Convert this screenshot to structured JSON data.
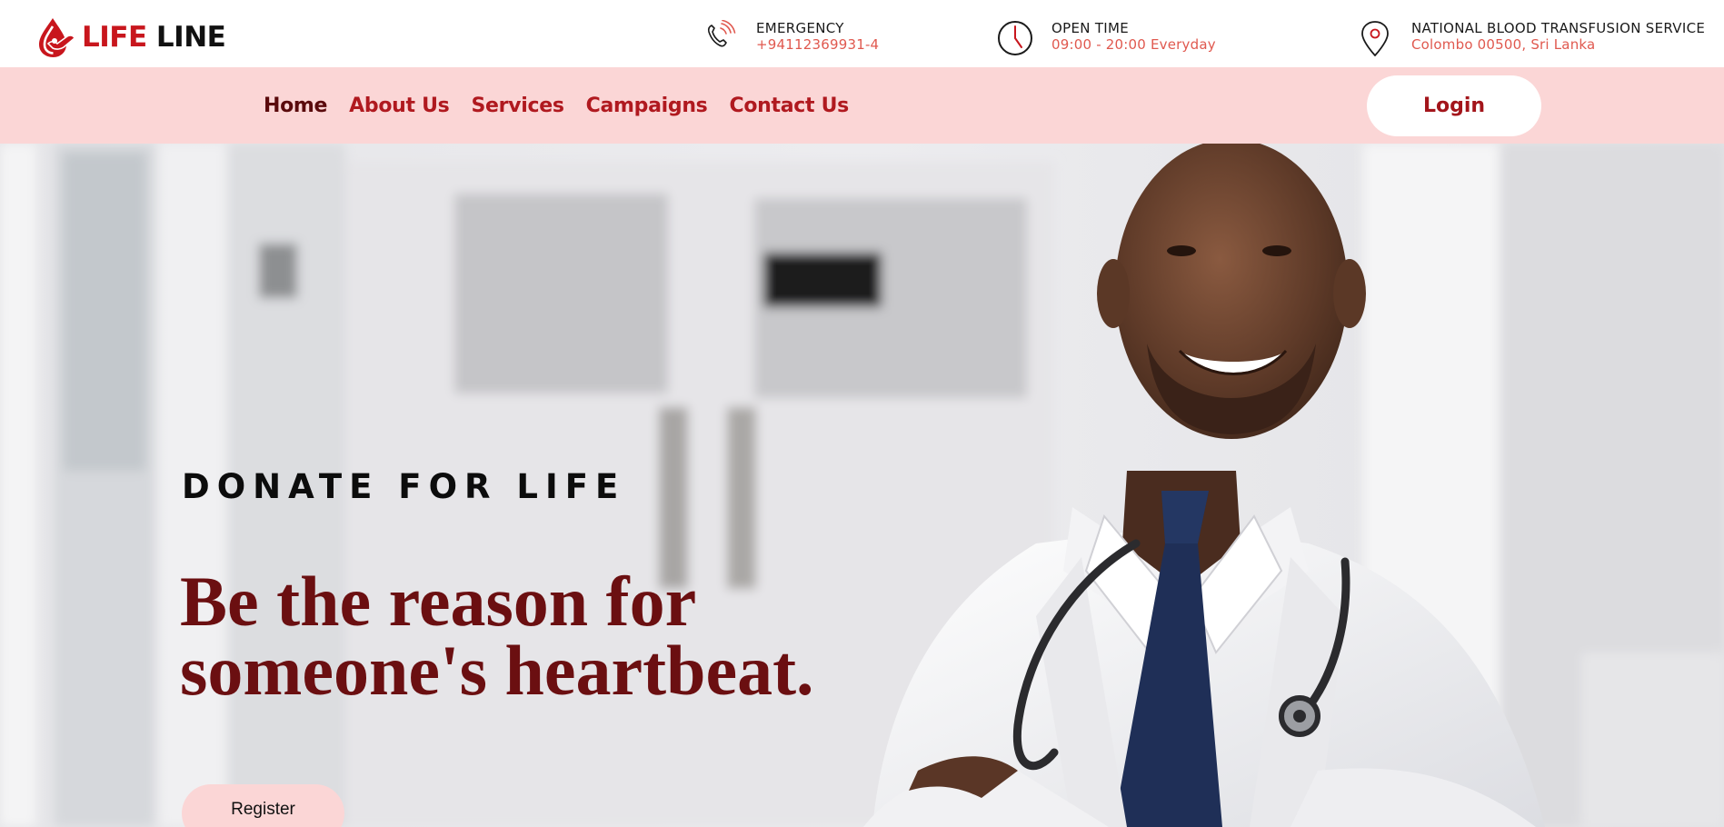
{
  "brand": {
    "name_part1": "LIFE",
    "name_part2": " LINE",
    "accent_color": "#c8161d"
  },
  "contact_info": [
    {
      "icon": "phone-icon",
      "label": "EMERGENCY",
      "value": "+94112369931-4"
    },
    {
      "icon": "clock-icon",
      "label": "OPEN TIME",
      "value": "09:00 - 20:00 Everyday"
    },
    {
      "icon": "location-pin-icon",
      "label": "NATIONAL BLOOD TRANSFUSION SERVICE",
      "value": "Colombo 00500, Sri Lanka"
    }
  ],
  "nav": {
    "items": [
      {
        "label": "Home",
        "active": true
      },
      {
        "label": "About Us",
        "active": false
      },
      {
        "label": "Services",
        "active": false
      },
      {
        "label": "Campaigns",
        "active": false
      },
      {
        "label": "Contact Us",
        "active": false
      }
    ],
    "login_label": "Login",
    "background_color": "#fbd6d6"
  },
  "hero": {
    "eyebrow": "DONATE FOR LIFE",
    "headline": "Be the reason for someone's heartbeat.",
    "register_label": "Register",
    "image": "doctor-photo"
  }
}
